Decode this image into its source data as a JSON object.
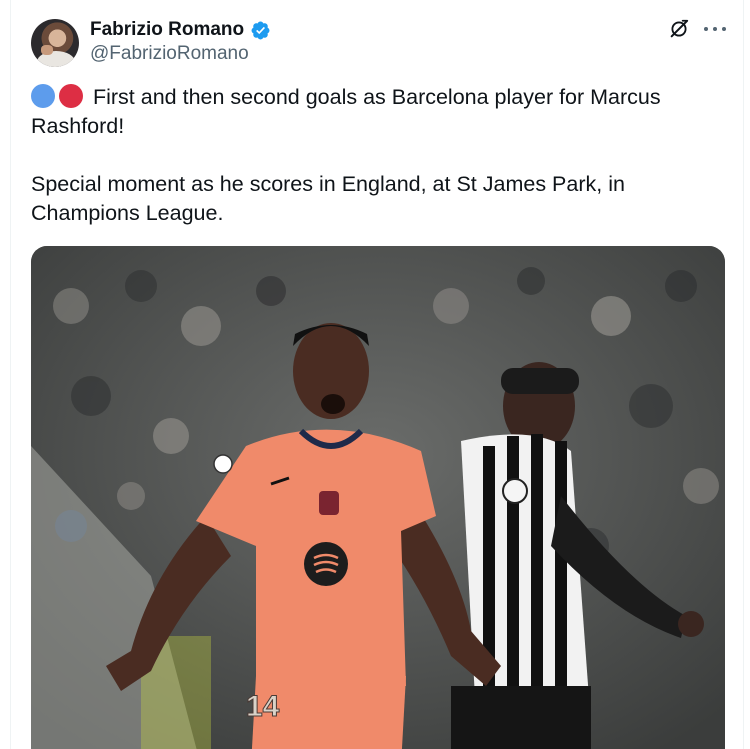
{
  "author": {
    "display_name": "Fabrizio Romano",
    "handle": "@FabrizioRomano",
    "verified": true,
    "avatar_icon": "profile-photo"
  },
  "actions": {
    "grok_icon": "grok-icon",
    "more_icon": "more-icon"
  },
  "tweet": {
    "emojis": [
      "blue-circle",
      "red-circle"
    ],
    "line1": "First and then second goals as Barcelona player for Marcus Rashford!",
    "line2": "Special moment as he scores in England, at St James Park, in Champions League."
  },
  "media": {
    "kit_number": "14"
  },
  "colors": {
    "verified_blue": "#1d9bf0",
    "text": "#0f1419",
    "secondary": "#536471",
    "emoji_blue": "#5d9cec",
    "emoji_red": "#dd2e44"
  }
}
